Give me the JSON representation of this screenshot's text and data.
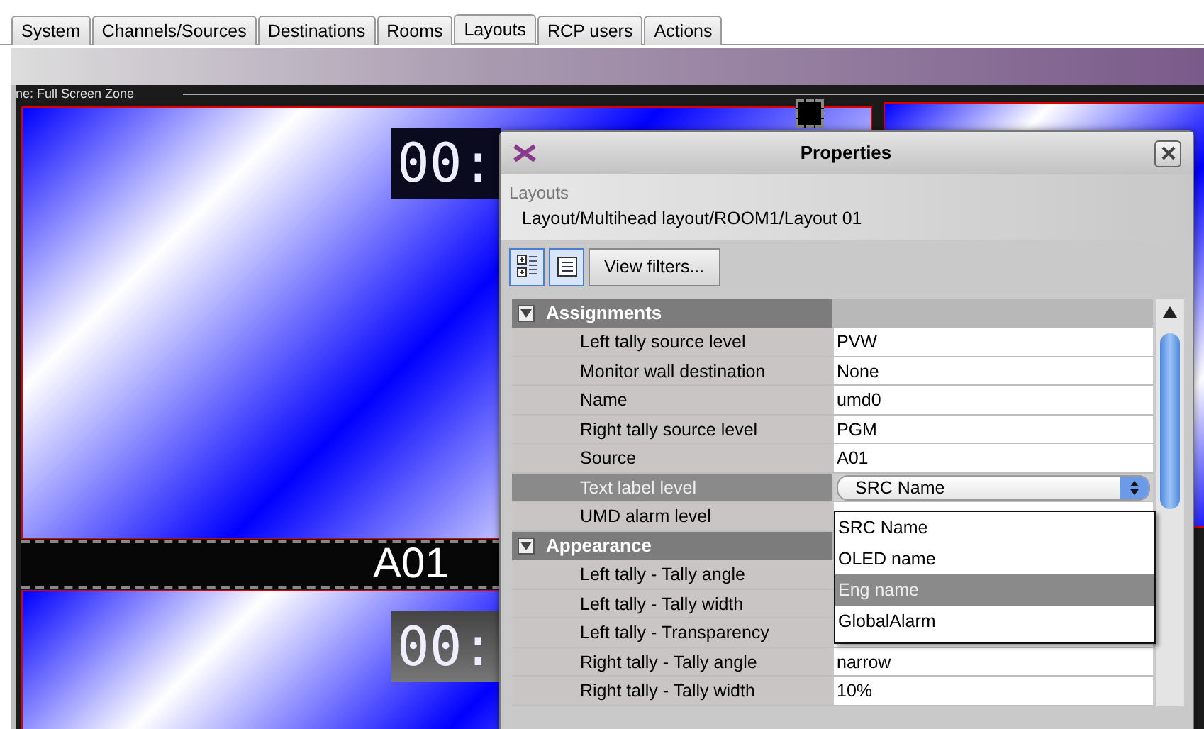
{
  "tabs": [
    {
      "label": "System",
      "selected": false
    },
    {
      "label": "Channels/Sources",
      "selected": false
    },
    {
      "label": "Destinations",
      "selected": false
    },
    {
      "label": "Rooms",
      "selected": false
    },
    {
      "label": "Layouts",
      "selected": true
    },
    {
      "label": "RCP users",
      "selected": false
    },
    {
      "label": "Actions",
      "selected": false
    }
  ],
  "canvas": {
    "zone_label": "ne: Full Screen Zone",
    "monitors": [
      {
        "timer": "00:",
        "umd_label": "A01"
      },
      {
        "timer": "00:"
      }
    ]
  },
  "dialog": {
    "title": "Properties",
    "context_label": "Layouts",
    "path": "Layout/Multihead layout/ROOM1/Layout 01",
    "view_buttons": [
      {
        "kind": "categorized",
        "selected": true
      },
      {
        "kind": "list",
        "selected": true
      }
    ],
    "filter_button": "View filters...",
    "sections": [
      {
        "title": "Assignments",
        "expanded": true,
        "rows": [
          {
            "label": "Left tally source level",
            "value": "PVW",
            "kind": "text",
            "selected": false
          },
          {
            "label": "Monitor wall destination",
            "value": "None",
            "kind": "text",
            "selected": false
          },
          {
            "label": "Name",
            "value": "umd0",
            "kind": "text",
            "selected": false
          },
          {
            "label": "Right tally source level",
            "value": "PGM",
            "kind": "text",
            "selected": false
          },
          {
            "label": "Source",
            "value": "A01",
            "kind": "text",
            "selected": false
          },
          {
            "label": "Text label level",
            "value": "SRC Name",
            "kind": "combo",
            "selected": true
          },
          {
            "label": "UMD alarm level",
            "kind": "text",
            "selected": false
          }
        ]
      },
      {
        "title": "Appearance",
        "expanded": true,
        "rows": [
          {
            "label": "Left tally - Tally angle",
            "kind": "text",
            "selected": false
          },
          {
            "label": "Left tally - Tally width",
            "kind": "text",
            "selected": false
          },
          {
            "label": "Left tally - Transparency",
            "kind": "text",
            "selected": false
          },
          {
            "label": "Right tally - Tally angle",
            "value": "narrow",
            "kind": "text",
            "selected": false
          },
          {
            "label": "Right tally - Tally width",
            "value": "10%",
            "kind": "text",
            "selected": false
          }
        ]
      }
    ],
    "dropdown": {
      "items": [
        {
          "label": "SRC Name",
          "selected": false
        },
        {
          "label": "OLED name",
          "selected": false
        },
        {
          "label": "Eng name",
          "selected": true
        },
        {
          "label": "GlobalAlarm",
          "selected": false
        }
      ]
    }
  }
}
